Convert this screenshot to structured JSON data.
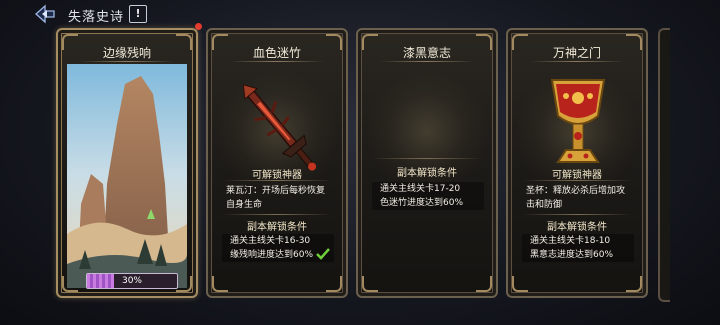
{
  "topbar": {
    "title": "失落史诗",
    "info_label": "!"
  },
  "cards": [
    {
      "title": "边缘残响",
      "progress_text": "30%",
      "progress_value": 0.3
    },
    {
      "title": "血色迷竹",
      "unlock_label": "可解锁神器",
      "description": "莱瓦汀：开场后每秒恢复自身生命",
      "condition_label": "副本解锁条件",
      "conditions": [
        "通关主线关卡16-30",
        "缘残响进度达到60%"
      ]
    },
    {
      "title": "漆黑意志",
      "condition_label": "副本解锁条件",
      "conditions": [
        "通关主线关卡17-20",
        "色迷竹进度达到60%"
      ]
    },
    {
      "title": "万神之门",
      "unlock_label": "可解锁神器",
      "description": "圣杯：释放必杀后增加攻击和防御",
      "condition_label": "副本解锁条件",
      "conditions": [
        "通关主线关卡18-10",
        "黑意志进度达到60%"
      ]
    }
  ],
  "colors": {
    "accent_gold": "#a78d62",
    "progress": "#b76ad6",
    "notification": "#e23b2e",
    "check": "#6fcf3a"
  }
}
